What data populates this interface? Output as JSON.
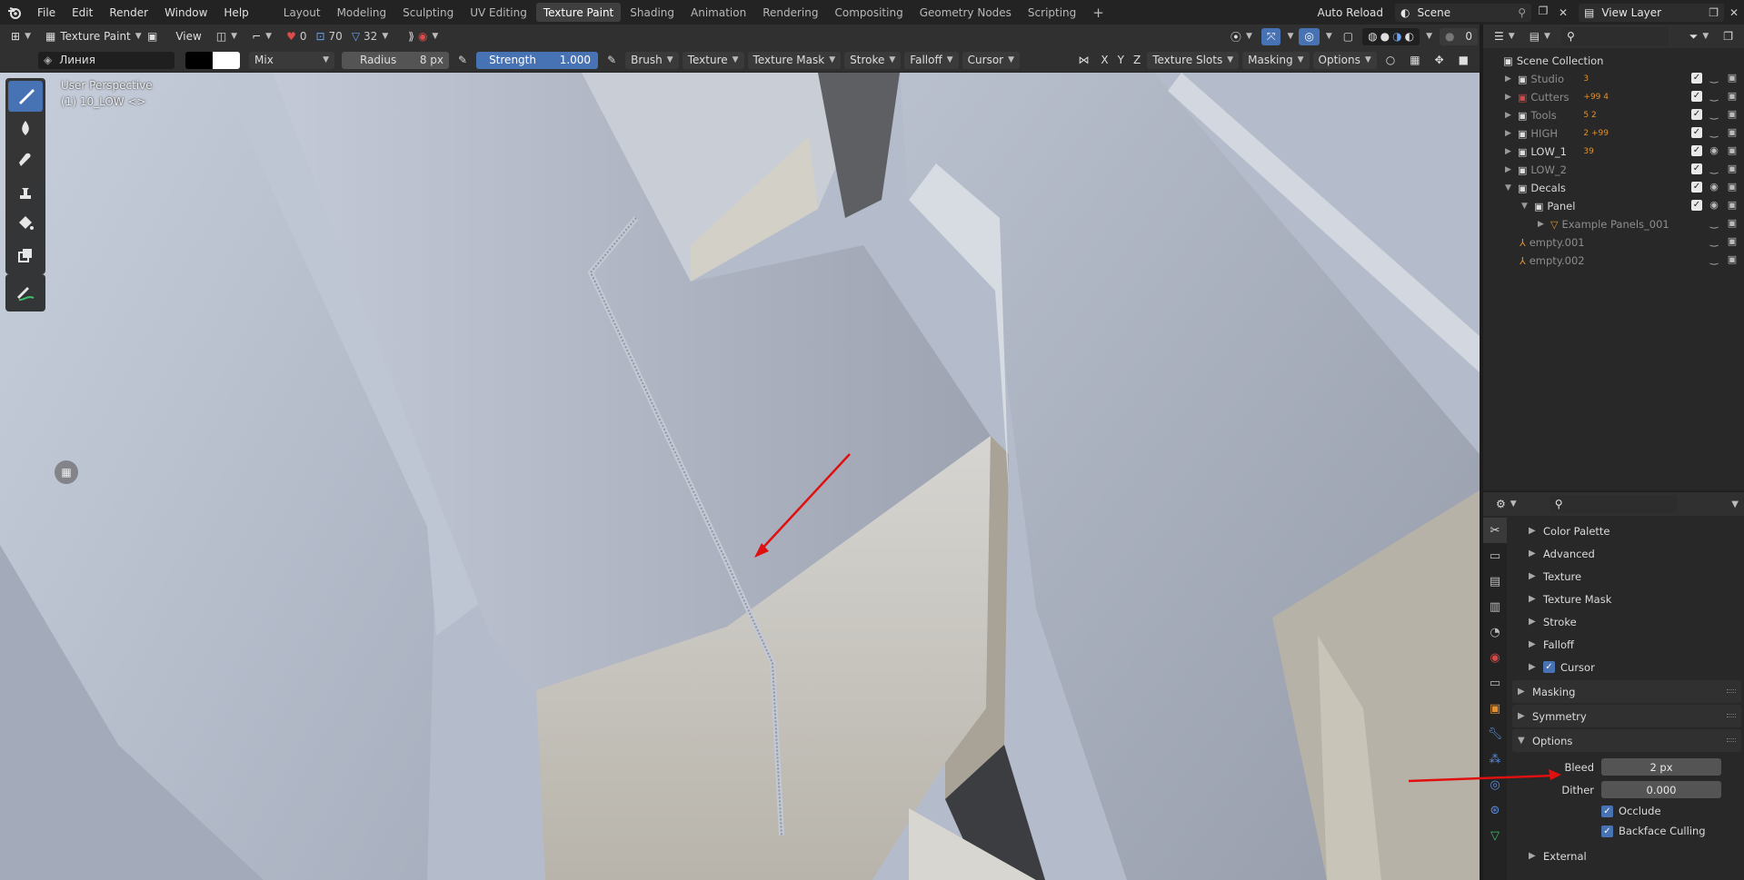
{
  "menu": [
    "File",
    "Edit",
    "Render",
    "Window",
    "Help"
  ],
  "workspaces": [
    "Layout",
    "Modeling",
    "Sculpting",
    "UV Editing",
    "Texture Paint",
    "Shading",
    "Animation",
    "Rendering",
    "Compositing",
    "Geometry Nodes",
    "Scripting"
  ],
  "active_workspace": "Texture Paint",
  "top_right": {
    "auto_reload": "Auto Reload",
    "scene": "Scene",
    "view_layer": "View Layer"
  },
  "header1": {
    "mode": "Texture Paint",
    "view": "View",
    "stat_a": "0",
    "stat_b": "70",
    "stat_c": "32",
    "overlay_count": "0"
  },
  "header2": {
    "brush_name": "Линия",
    "blend": "Mix",
    "radius_label": "Radius",
    "radius_value": "8 px",
    "strength_label": "Strength",
    "strength_value": "1.000",
    "strength_fraction": 1.0,
    "menus": [
      "Brush",
      "Texture",
      "Texture Mask",
      "Stroke",
      "Falloff",
      "Cursor"
    ],
    "axes": [
      "X",
      "Y",
      "Z"
    ],
    "right_menus": [
      "Texture Slots",
      "Masking",
      "Options"
    ]
  },
  "viewport": {
    "perspective": "User Perspective",
    "object": "(1) 10_LOW <>"
  },
  "outliner": {
    "root": "Scene Collection",
    "items": [
      {
        "name": "Studio",
        "badges": "3",
        "visible": false,
        "dim": true
      },
      {
        "name": "Cutters",
        "badges": "+99 4",
        "visible": false,
        "dim": true,
        "red": true
      },
      {
        "name": "Tools",
        "badges": "5 2",
        "visible": false,
        "dim": true
      },
      {
        "name": "HIGH",
        "badges": "2 +99",
        "visible": false,
        "dim": true
      },
      {
        "name": "LOW_1",
        "badges": "39",
        "visible": true,
        "dim": false
      },
      {
        "name": "LOW_2",
        "badges": "",
        "visible": false,
        "dim": true
      },
      {
        "name": "Decals",
        "badges": "",
        "visible": true,
        "dim": false,
        "expanded": true
      },
      {
        "name": "Panel",
        "badges": "",
        "visible": true,
        "dim": false,
        "expanded": true,
        "indent": 1
      },
      {
        "name": "Example Panels_001",
        "badges": "",
        "visible": false,
        "dim": true,
        "indent": 2
      },
      {
        "name": "empty.001",
        "badges": "",
        "visible": false,
        "dim": true,
        "object": true
      },
      {
        "name": "empty.002",
        "badges": "",
        "visible": false,
        "dim": true,
        "object": true
      }
    ]
  },
  "properties": {
    "subpanels": [
      "Color Palette",
      "Advanced",
      "Texture",
      "Texture Mask",
      "Stroke",
      "Falloff",
      "Cursor"
    ],
    "cursor_checked": true,
    "panels": [
      "Masking",
      "Symmetry",
      "Options"
    ],
    "bleed_label": "Bleed",
    "bleed_value": "2 px",
    "dither_label": "Dither",
    "dither_value": "0.000",
    "occlude_label": "Occlude",
    "occlude_checked": true,
    "backface_label": "Backface Culling",
    "backface_checked": true,
    "external_label": "External"
  },
  "colors": {
    "accent": "#4772b3",
    "annotation_arrow": "#e01010",
    "panel_bg": "#282828",
    "header_bg": "#303030"
  }
}
